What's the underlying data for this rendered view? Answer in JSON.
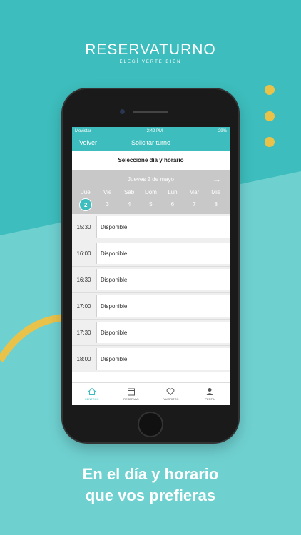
{
  "brand": {
    "name": "RESERVATURNO",
    "tagline": "ELEGÍ VERTE BIEN"
  },
  "caption": {
    "line1": "En el día y horario",
    "line2": "que vos prefieras"
  },
  "status_bar": {
    "carrier": "Movistar",
    "time": "2:42 PM",
    "battery": "29%"
  },
  "nav": {
    "back_label": "Volver",
    "title": "Solicitar turno"
  },
  "section_title": "Seleccione día y horario",
  "date_header": {
    "label": "Jueves 2 de mayo",
    "next_icon": "arrow-right-icon"
  },
  "days": [
    {
      "name": "Jue",
      "num": "2"
    },
    {
      "name": "Vie",
      "num": "3"
    },
    {
      "name": "Sáb",
      "num": "4"
    },
    {
      "name": "Dom",
      "num": "5"
    },
    {
      "name": "Lun",
      "num": "6"
    },
    {
      "name": "Mar",
      "num": "7"
    },
    {
      "name": "Mié",
      "num": "8"
    }
  ],
  "slots": [
    {
      "time": "15:30",
      "status": "Disponible"
    },
    {
      "time": "16:00",
      "status": "Disponible"
    },
    {
      "time": "16:30",
      "status": "Disponible"
    },
    {
      "time": "17:00",
      "status": "Disponible"
    },
    {
      "time": "17:30",
      "status": "Disponible"
    },
    {
      "time": "18:00",
      "status": "Disponible"
    }
  ],
  "tabs": [
    {
      "label": "CENTROS",
      "icon": "home-icon"
    },
    {
      "label": "RESERVAS",
      "icon": "calendar-icon"
    },
    {
      "label": "FAVORITOS",
      "icon": "heart-icon"
    },
    {
      "label": "PERFIL",
      "icon": "person-icon"
    }
  ],
  "colors": {
    "accent": "#3dbdbd",
    "yellow": "#e9c24a",
    "date_bar": "#c8c8c8"
  }
}
